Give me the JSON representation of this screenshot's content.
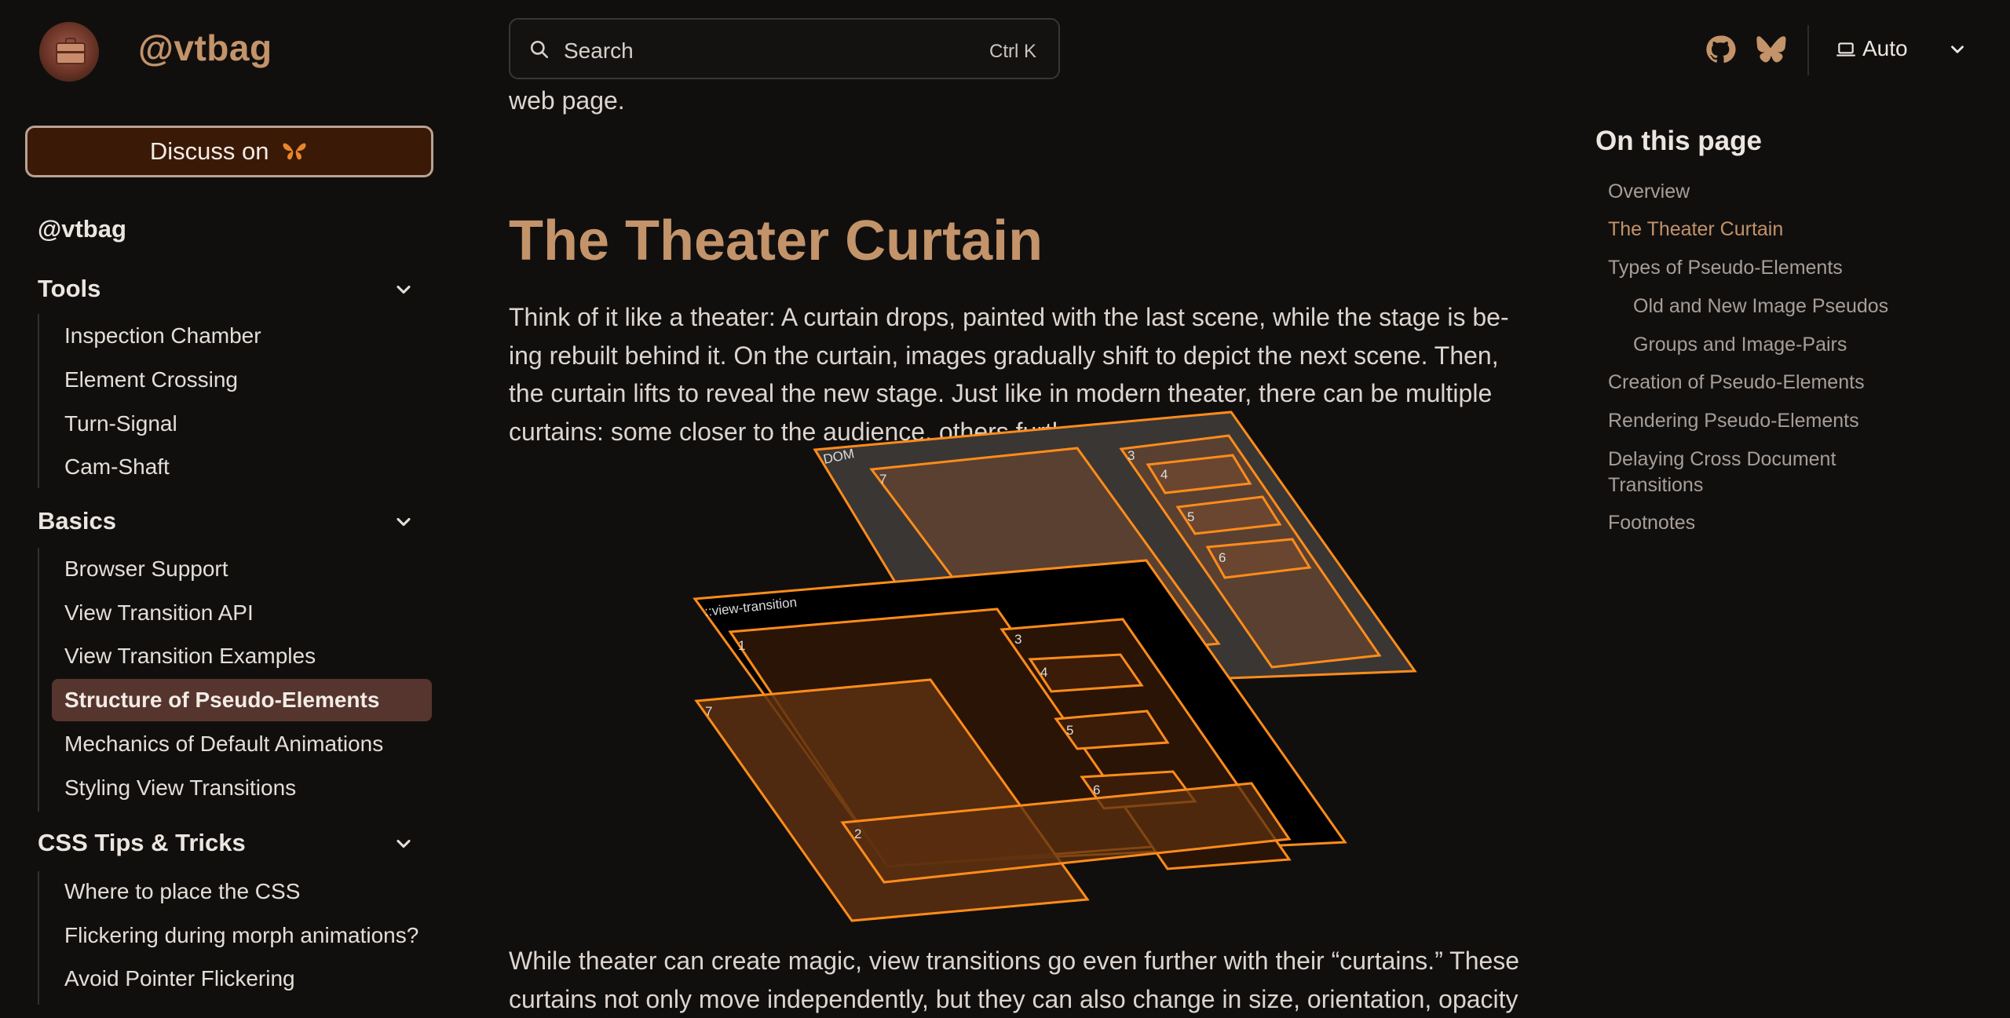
{
  "header": {
    "site_title": "@vtbag",
    "search": {
      "placeholder": "Search",
      "shortcut": "Ctrl K"
    },
    "icons": [
      "github-icon",
      "bluesky-icon"
    ],
    "theme": {
      "selected": "Auto"
    }
  },
  "sidebar": {
    "discuss_label": "Discuss on",
    "root_label": "@vtbag",
    "groups": [
      {
        "label": "Tools",
        "items": [
          "Inspection Chamber",
          "Element Crossing",
          "Turn-Signal",
          "Cam-Shaft"
        ]
      },
      {
        "label": "Basics",
        "items": [
          "Browser Support",
          "View Transition API",
          "View Transition Examples",
          "Structure of Pseudo-Elements",
          "Mechanics of Default Animations",
          "Styling View Transitions"
        ],
        "active_item": "Structure of Pseudo-Elements"
      },
      {
        "label": "CSS Tips & Tricks",
        "items": [
          "Where to place the CSS",
          "Flickering during morph animations?",
          "Avoid Pointer Flickering"
        ]
      }
    ]
  },
  "main": {
    "fragment": "web page.",
    "heading": "The Theater Curtain",
    "paragraph": "Think of it like a theater: A curtain drops, painted with the last scene, while the stage is be­ing rebuilt behind it. On the curtain, images gradually shift to depict the next scene. Then, the curtain lifts to reveal the new stage. Just like in modern theater, there can be multiple curtains: some closer to the audience, others furth",
    "paragraph2": "While theater can create magic, view transitions go even further with their “curtains.” These curtains not only move independently, but they can also change in size, orientation, opacity",
    "diagram": {
      "dom_label": "DOM",
      "vt_label": "::view-transition",
      "dom_numbers": [
        "7",
        "3",
        "4",
        "5",
        "6"
      ],
      "vt_numbers": [
        "1",
        "3",
        "4",
        "5",
        "6",
        "7",
        "2"
      ]
    }
  },
  "toc": {
    "title": "On this page",
    "items": [
      {
        "label": "Overview",
        "level": 1
      },
      {
        "label": "The Theater Curtain",
        "level": 1,
        "current": true
      },
      {
        "label": "Types of Pseudo-Elements",
        "level": 1
      },
      {
        "label": "Old and New Image Pseudos",
        "level": 2
      },
      {
        "label": "Groups and Image-Pairs",
        "level": 2
      },
      {
        "label": "Creation of Pseudo-Elements",
        "level": 1
      },
      {
        "label": "Rendering Pseudo-Elements",
        "level": 1
      },
      {
        "label": "Delaying Cross Document Transitions",
        "level": 1
      },
      {
        "label": "Footnotes",
        "level": 1
      }
    ]
  },
  "colors": {
    "accent": "#c3936a",
    "background": "#110f0e",
    "active_bg": "#55352e",
    "diagram_orange": "#ff8c1a"
  }
}
